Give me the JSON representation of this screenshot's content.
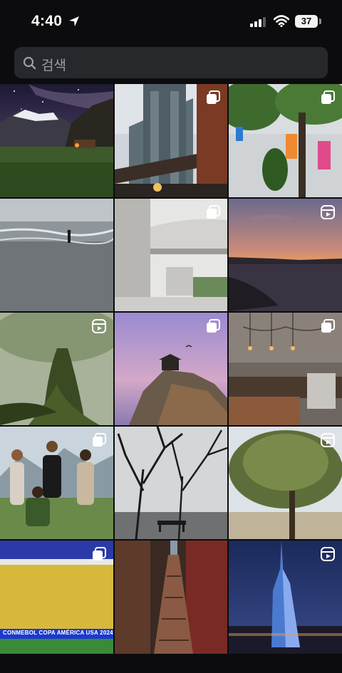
{
  "status_bar": {
    "time": "4:40",
    "battery": "37"
  },
  "search": {
    "placeholder": "검색"
  },
  "grid": {
    "tiles": [
      {
        "subject": "Mountain valley under a starry night sky",
        "badge": "none"
      },
      {
        "subject": "Manhattan Bridge seen between brick buildings",
        "badge": "carousel"
      },
      {
        "subject": "Tree-lined plaza with colorful sculptures",
        "badge": "carousel"
      },
      {
        "subject": "Surfer walking on a misty beach",
        "badge": "none"
      },
      {
        "subject": "Modern white concrete building interior",
        "badge": "carousel"
      },
      {
        "subject": "Sunset over a calm bay",
        "badge": "reel"
      },
      {
        "subject": "Moss-covered tree in a foggy forest",
        "badge": "reel"
      },
      {
        "subject": "Pavilion on a cliff at dusk",
        "badge": "carousel"
      },
      {
        "subject": "Café counter with pendant lamps",
        "badge": "carousel"
      },
      {
        "subject": "Group of four friends posing in the mountains",
        "badge": "carousel"
      },
      {
        "subject": "Bare trees with a bench by the water",
        "badge": "none"
      },
      {
        "subject": "Willow tree in an open field",
        "badge": "reel"
      },
      {
        "subject": "Stadium crowd in yellow at CONMEBOL COPA AMÉRICA USA 2024",
        "badge": "carousel",
        "banner": "CONMEBOL COPA AMÉRICA USA 2024"
      },
      {
        "subject": "Narrow brick alley staircase",
        "badge": "none"
      },
      {
        "subject": "Illuminated skyscraper over the city at dusk",
        "badge": "reel"
      }
    ]
  },
  "colors": {
    "background": "#0c0c0e",
    "search_bg": "#26282c",
    "placeholder": "#9b9ea5"
  },
  "icons": {
    "location": "location-arrow-icon",
    "signal": "cellular-signal-icon",
    "wifi": "wifi-icon",
    "search": "search-icon",
    "carousel": "carousel-icon",
    "reel": "reel-icon"
  }
}
